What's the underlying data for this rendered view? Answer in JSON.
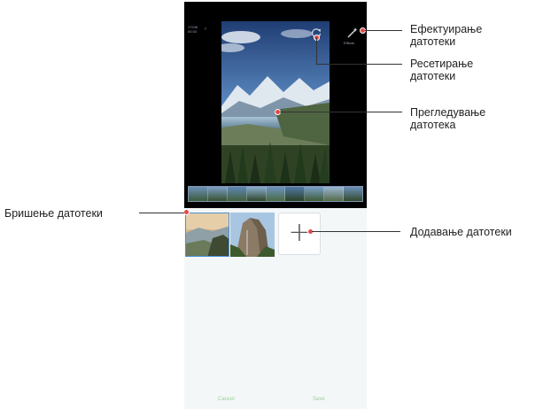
{
  "topbar": {
    "left_line1": "17246",
    "left_line2": "00:34",
    "mid_line1": "17148",
    "mid_line2": "00:16",
    "effect_caption": "Effects"
  },
  "icons": {
    "reset": "reset-icon",
    "effect": "magic-wand-icon",
    "add": "plus-icon"
  },
  "add_glyph": "+",
  "buttons": {
    "cancel": "Cancel",
    "save": "Save"
  },
  "callouts": {
    "effect": [
      "Ефектуирање",
      "датотеки"
    ],
    "reset": [
      "Ресетирање",
      "датотеки"
    ],
    "preview": [
      "Прегледување",
      "датотека"
    ],
    "delete": "Бришење датотеки",
    "add": "Додавање датотеки"
  },
  "colors": {
    "accent_dot": "#e64848",
    "button_text": "#9ccf9c",
    "selection": "#4a90d9"
  }
}
